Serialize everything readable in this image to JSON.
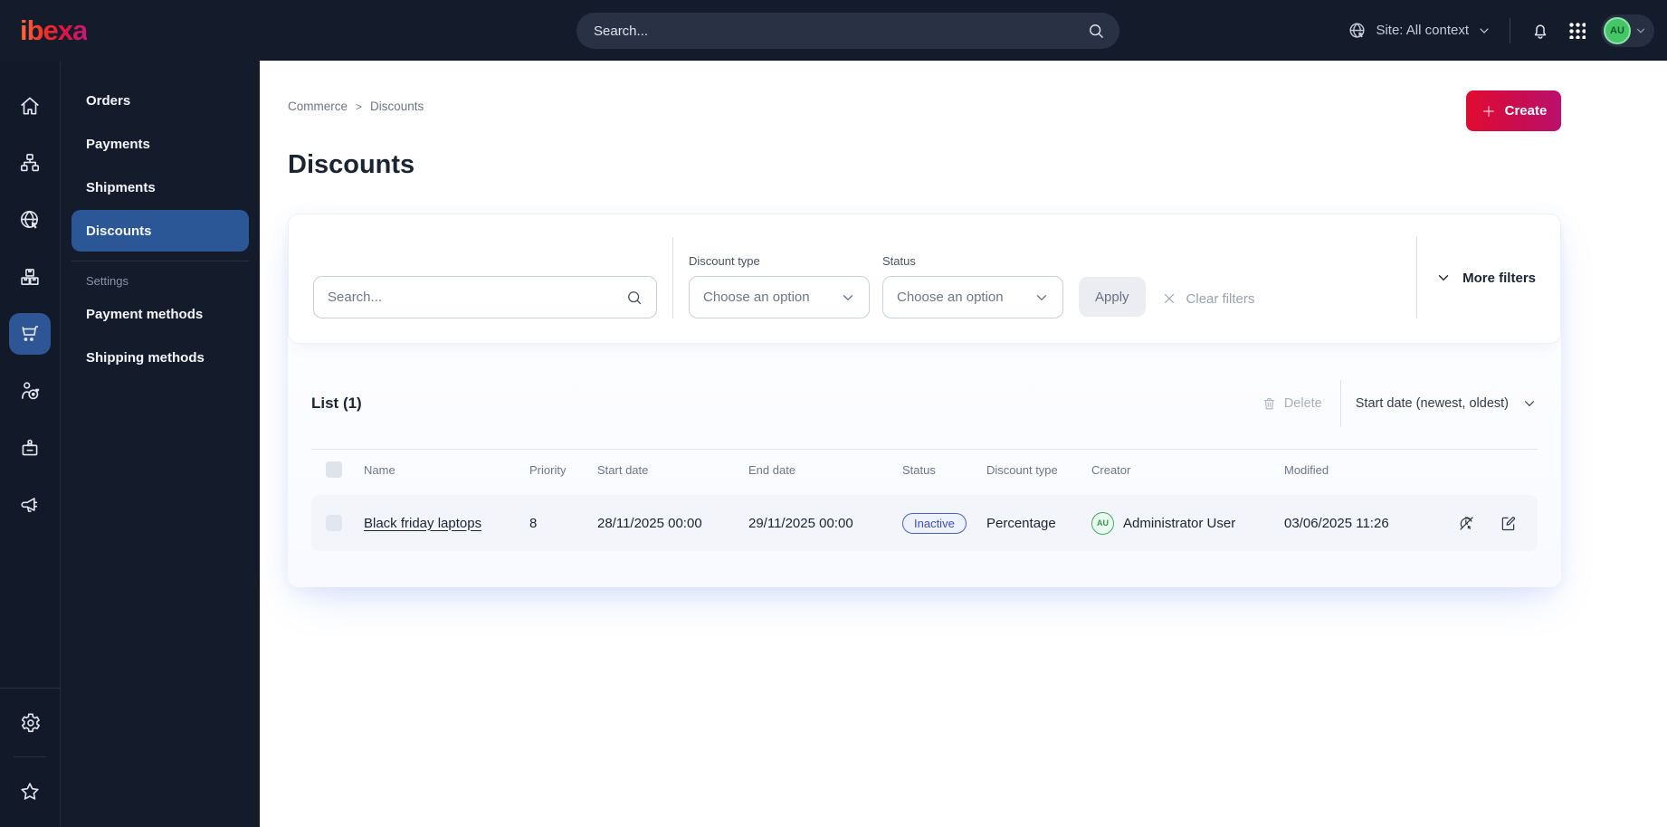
{
  "colors": {
    "topbar_bg": "#141b2b",
    "accent_red": "#e00b31",
    "accent_magenta": "#bb106e",
    "active_blue": "#2c5796",
    "badge_blue": "#3a4ec6",
    "avatar_green": "#3fae5e"
  },
  "topbar": {
    "logo": "ibexa",
    "search_placeholder": "Search...",
    "site_context": "Site: All context",
    "icons": [
      "site-globe-icon",
      "bell-icon",
      "app-grid-icon",
      "chevron-down-icon"
    ],
    "user_initials": "AU"
  },
  "rail": {
    "items": [
      {
        "icon": "home-icon"
      },
      {
        "icon": "content-tree-icon"
      },
      {
        "icon": "site-cursor-icon"
      },
      {
        "icon": "products-boxes-icon"
      },
      {
        "icon": "commerce-cart-icon",
        "active": true
      },
      {
        "icon": "customers-target-icon"
      },
      {
        "icon": "store-badge-icon"
      },
      {
        "icon": "marketing-megaphone-icon"
      }
    ],
    "bottom": [
      {
        "icon": "gear-icon"
      },
      {
        "icon": "star-icon"
      }
    ]
  },
  "sidebar": {
    "items": [
      {
        "label": "Orders"
      },
      {
        "label": "Payments"
      },
      {
        "label": "Shipments"
      },
      {
        "label": "Discounts",
        "active": true
      }
    ],
    "settings_label": "Settings",
    "settings_items": [
      {
        "label": "Payment methods"
      },
      {
        "label": "Shipping methods"
      }
    ]
  },
  "breadcrumb": {
    "items": [
      "Commerce",
      "Discounts"
    ],
    "separator": ">"
  },
  "page": {
    "title": "Discounts",
    "create_label": "Create"
  },
  "filters": {
    "search_placeholder": "Search...",
    "discount_type_label": "Discount type",
    "status_label": "Status",
    "choose_option": "Choose an option",
    "apply_label": "Apply",
    "clear_label": "Clear filters",
    "more_label": "More filters"
  },
  "list": {
    "title": "List (1)",
    "delete_label": "Delete",
    "sort_label": "Start date (newest, oldest)",
    "columns": [
      "Name",
      "Priority",
      "Start date",
      "End date",
      "Status",
      "Discount type",
      "Creator",
      "Modified"
    ],
    "rows": [
      {
        "name": "Black friday laptops",
        "priority": "8",
        "start_date": "28/11/2025 00:00",
        "end_date": "29/11/2025 00:00",
        "status": "Inactive",
        "discount_type": "Percentage",
        "creator_initials": "AU",
        "creator": "Administrator User",
        "modified": "03/06/2025 11:26",
        "action_icons": [
          "deactivate-icon",
          "edit-icon"
        ]
      }
    ]
  }
}
